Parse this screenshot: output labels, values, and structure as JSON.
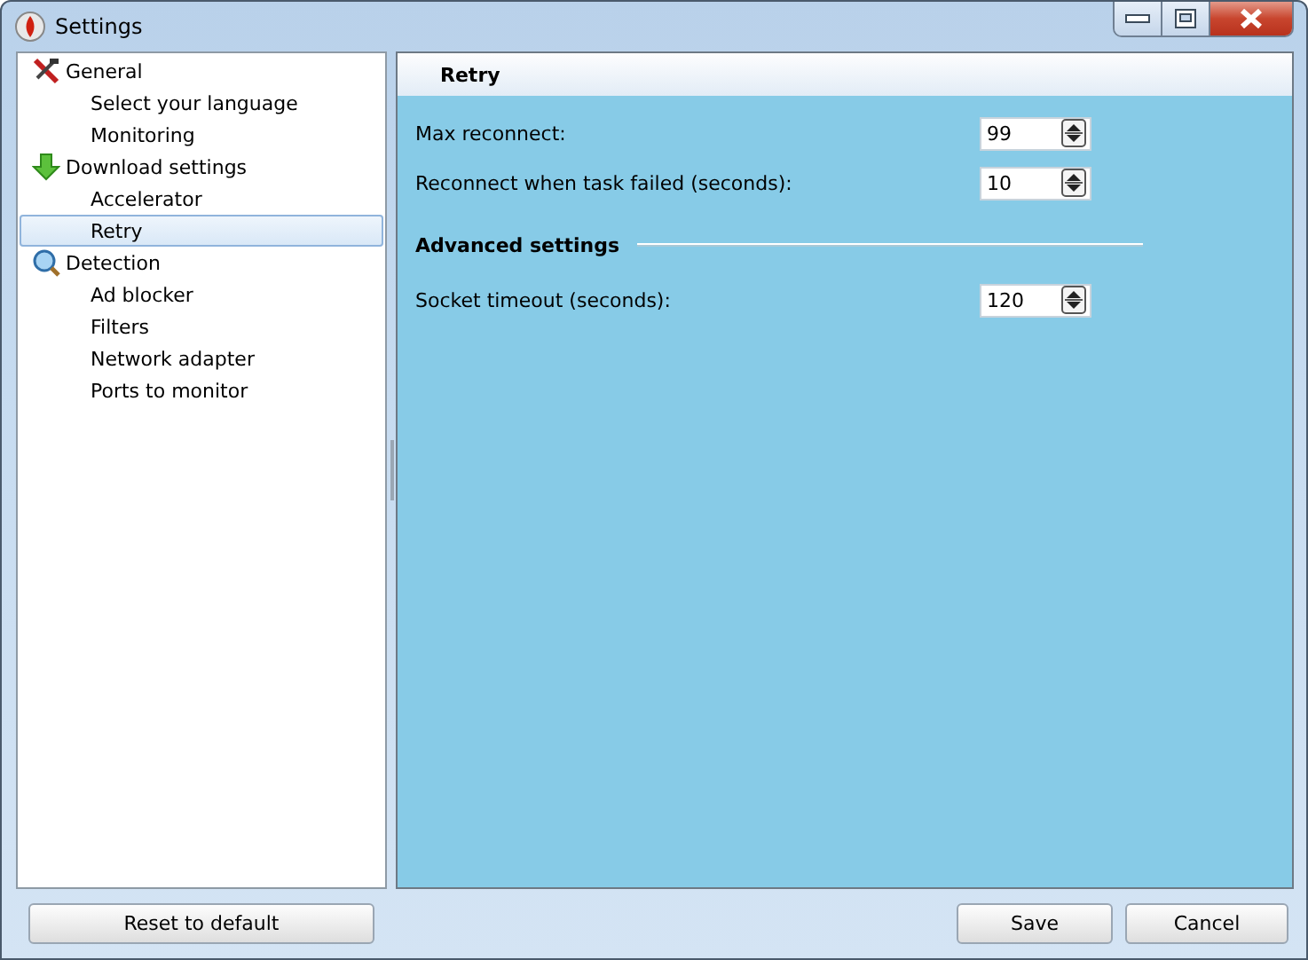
{
  "window": {
    "title": "Settings"
  },
  "sidebar": {
    "items": [
      {
        "label": "General",
        "selected": false,
        "children": [
          {
            "label": "Select your language",
            "selected": false
          },
          {
            "label": "Monitoring",
            "selected": false
          }
        ]
      },
      {
        "label": "Download settings",
        "selected": false,
        "children": [
          {
            "label": "Accelerator",
            "selected": false
          },
          {
            "label": "Retry",
            "selected": true
          }
        ]
      },
      {
        "label": "Detection",
        "selected": false,
        "children": [
          {
            "label": "Ad blocker",
            "selected": false
          },
          {
            "label": "Filters",
            "selected": false
          },
          {
            "label": "Network adapter",
            "selected": false
          },
          {
            "label": "Ports to monitor",
            "selected": false
          }
        ]
      }
    ]
  },
  "panel": {
    "title": "Retry",
    "fields": [
      {
        "label": "Max reconnect:",
        "value": "99"
      },
      {
        "label": "Reconnect when task failed (seconds):",
        "value": "10"
      }
    ],
    "advanced": {
      "heading": "Advanced settings",
      "fields": [
        {
          "label": "Socket timeout (seconds):",
          "value": "120"
        }
      ]
    }
  },
  "buttons": {
    "reset": "Reset to default",
    "save": "Save",
    "cancel": "Cancel"
  }
}
